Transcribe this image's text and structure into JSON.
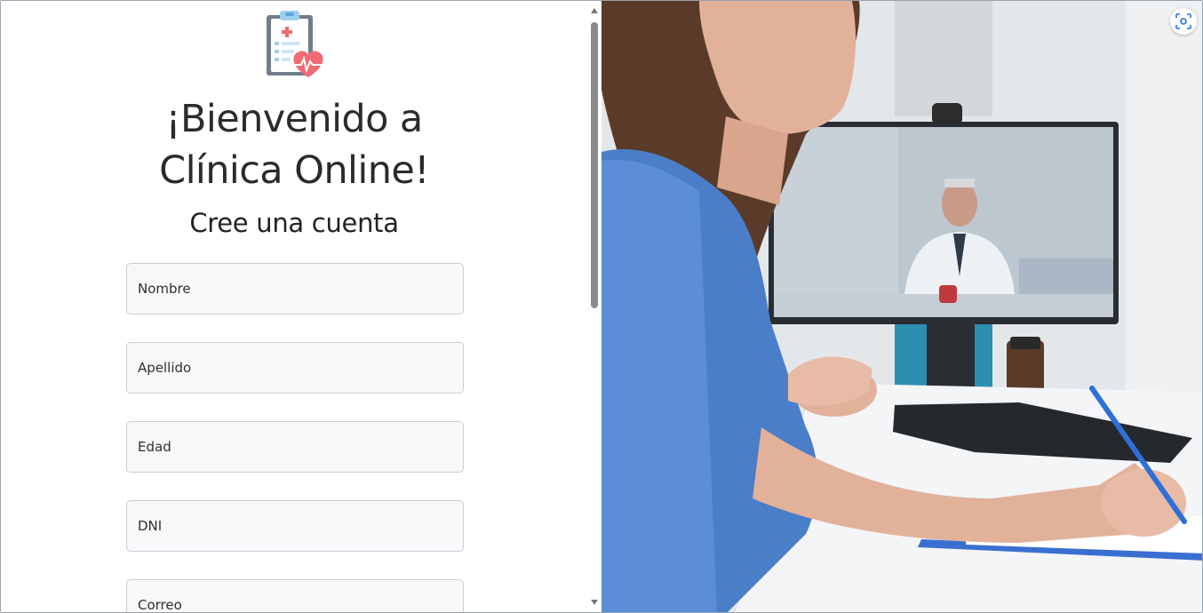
{
  "welcome": {
    "title_line1": "¡Bienvenido a",
    "title_line2": "Clínica Online!",
    "subtitle": "Cree una cuenta"
  },
  "form": {
    "fields": [
      {
        "label": "Nombre"
      },
      {
        "label": "Apellido"
      },
      {
        "label": "Edad"
      },
      {
        "label": "DNI"
      },
      {
        "label": "Correo"
      }
    ]
  },
  "icons": {
    "logo": "clipboard-heart-icon",
    "visual_search": "visual-search-icon",
    "scroll_up": "scroll-up-arrow-icon",
    "scroll_down": "scroll-down-arrow-icon"
  },
  "colors": {
    "heart": "#f06b73",
    "clipboard": "#6f7d8c",
    "scrub_blue": "#4a7ec9"
  }
}
